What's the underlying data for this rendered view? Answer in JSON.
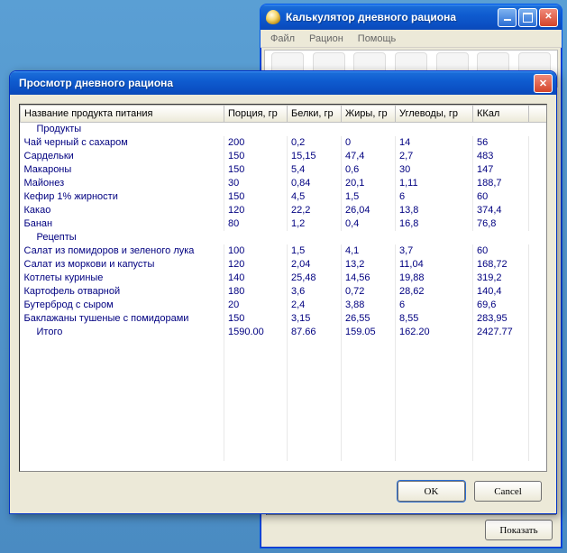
{
  "back_window": {
    "title": "Калькулятор дневного рациона",
    "menu": {
      "file": "Файл",
      "ration": "Рацион",
      "help": "Помощь"
    },
    "show_button": "Показать"
  },
  "dialog": {
    "title": "Просмотр дневного рациона",
    "ok": "OK",
    "cancel": "Cancel",
    "columns": {
      "name": "Название продукта питания",
      "portion": "Порция, гр",
      "protein": "Белки, гр",
      "fat": "Жиры, гр",
      "carbs": "Углеводы, гр",
      "kcal": "ККал"
    },
    "sections": {
      "products": "Продукты",
      "recipes": "Рецепты"
    },
    "rows_products": [
      {
        "name": "Чай черный с сахаром",
        "portion": "200",
        "protein": "0,2",
        "fat": "0",
        "carbs": "14",
        "kcal": "56"
      },
      {
        "name": "Сардельки",
        "portion": "150",
        "protein": "15,15",
        "fat": "47,4",
        "carbs": "2,7",
        "kcal": "483"
      },
      {
        "name": "Макароны",
        "portion": "150",
        "protein": "5,4",
        "fat": "0,6",
        "carbs": "30",
        "kcal": "147"
      },
      {
        "name": "Майонез",
        "portion": "30",
        "protein": "0,84",
        "fat": "20,1",
        "carbs": "1,11",
        "kcal": "188,7"
      },
      {
        "name": "Кефир 1% жирности",
        "portion": "150",
        "protein": "4,5",
        "fat": "1,5",
        "carbs": "6",
        "kcal": "60"
      },
      {
        "name": "Какао",
        "portion": "120",
        "protein": "22,2",
        "fat": "26,04",
        "carbs": "13,8",
        "kcal": "374,4"
      },
      {
        "name": "Банан",
        "portion": "80",
        "protein": "1,2",
        "fat": "0,4",
        "carbs": "16,8",
        "kcal": "76,8"
      }
    ],
    "rows_recipes": [
      {
        "name": "Салат из помидоров и зеленого лука",
        "portion": "100",
        "protein": "1,5",
        "fat": "4,1",
        "carbs": "3,7",
        "kcal": "60"
      },
      {
        "name": "Салат из моркови и капусты",
        "portion": "120",
        "protein": "2,04",
        "fat": "13,2",
        "carbs": "11,04",
        "kcal": "168,72"
      },
      {
        "name": "Котлеты куриные",
        "portion": "140",
        "protein": "25,48",
        "fat": "14,56",
        "carbs": "19,88",
        "kcal": "319,2"
      },
      {
        "name": "Картофель отварной",
        "portion": "180",
        "protein": "3,6",
        "fat": "0,72",
        "carbs": "28,62",
        "kcal": "140,4"
      },
      {
        "name": "Бутерброд с сыром",
        "portion": "20",
        "protein": "2,4",
        "fat": "3,88",
        "carbs": "6",
        "kcal": "69,6"
      },
      {
        "name": "Баклажаны тушеные с помидорами",
        "portion": "150",
        "protein": "3,15",
        "fat": "26,55",
        "carbs": "8,55",
        "kcal": "283,95"
      }
    ],
    "total": {
      "name": "Итого",
      "portion": "1590.00",
      "protein": "87.66",
      "fat": "159.05",
      "carbs": "162.20",
      "kcal": "2427.77"
    }
  }
}
